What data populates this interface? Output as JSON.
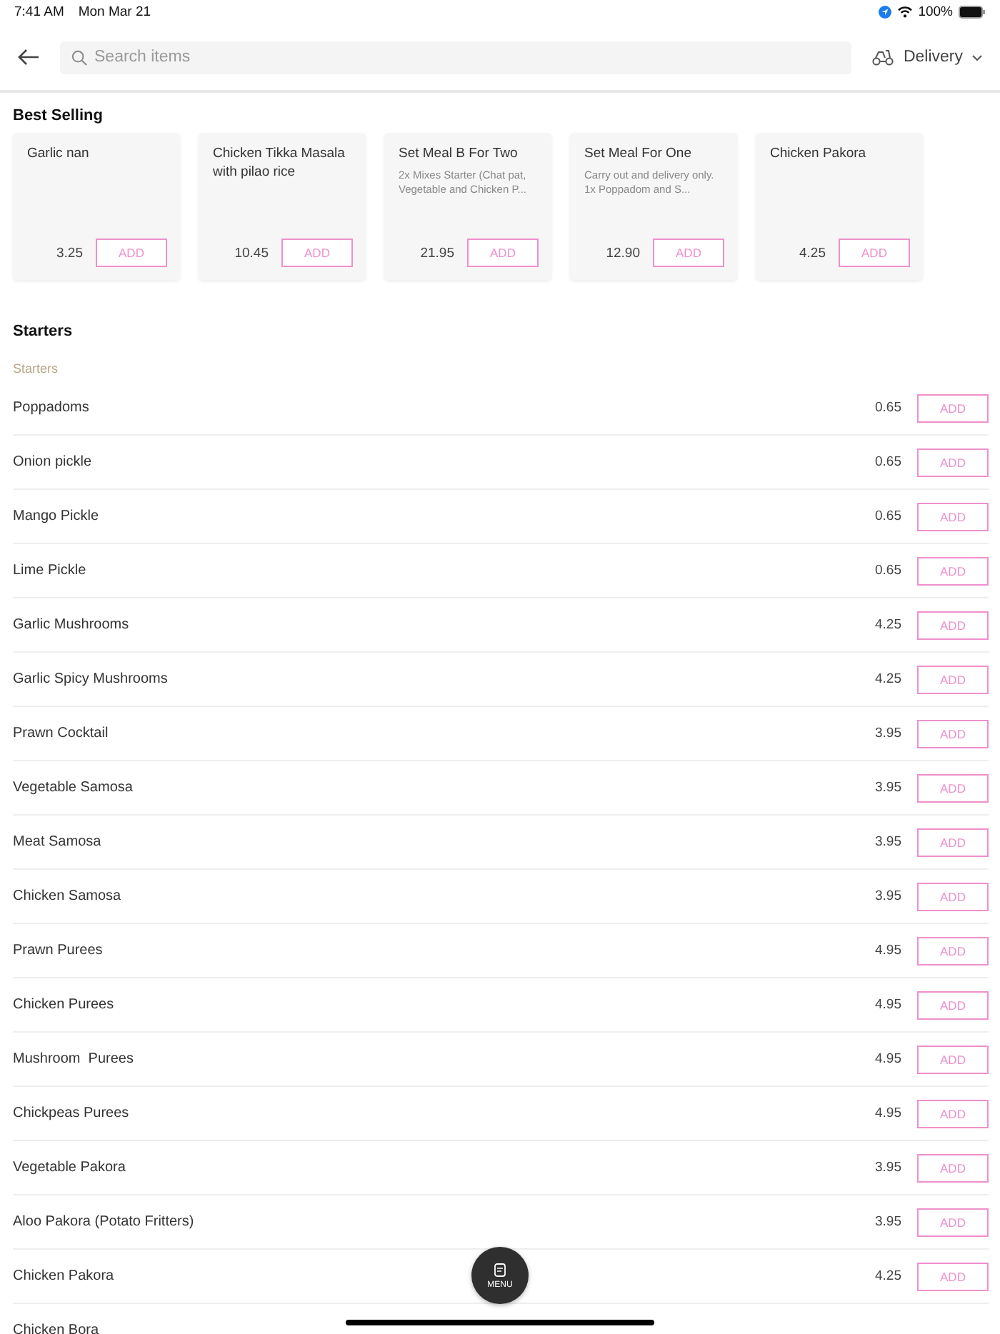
{
  "status_bar": {
    "time": "7:41 AM",
    "date": "Mon Mar 21",
    "battery": "100%"
  },
  "header": {
    "search": {
      "placeholder": "Search items"
    },
    "delivery": "Delivery"
  },
  "best_selling": {
    "title": "Best Selling",
    "items": [
      {
        "name": "Garlic nan",
        "price": "3.25",
        "button": "ADD"
      },
      {
        "name": "Chicken Tikka Masala with pilao rice",
        "price": "10.45",
        "button": "ADD"
      },
      {
        "name": "Set Meal B For Two",
        "description": "2x Mixes Starter (Chat pat, Vegetable and Chicken P...",
        "price": "21.95",
        "button": "ADD"
      },
      {
        "name": "Set Meal For One",
        "description": "Carry out and delivery only. 1x Poppadom and S...",
        "price": "12.90",
        "button": "ADD"
      },
      {
        "name": "Chicken Pakora",
        "price": "4.25",
        "button": "ADD"
      }
    ]
  },
  "section": {
    "title": "Starters",
    "subtitle": "Starters",
    "items": [
      {
        "name": "Poppadoms",
        "price": "0.65",
        "button": "ADD"
      },
      {
        "name": "Onion pickle",
        "price": "0.65",
        "button": "ADD"
      },
      {
        "name": "Mango Pickle",
        "price": "0.65",
        "button": "ADD"
      },
      {
        "name": "Lime Pickle",
        "price": "0.65",
        "button": "ADD"
      },
      {
        "name": "Garlic Mushrooms",
        "price": "4.25",
        "button": "ADD"
      },
      {
        "name": "Garlic Spicy Mushrooms",
        "price": "4.25",
        "button": "ADD"
      },
      {
        "name": "Prawn Cocktail",
        "price": "3.95",
        "button": "ADD"
      },
      {
        "name": "Vegetable Samosa",
        "price": "3.95",
        "button": "ADD"
      },
      {
        "name": "Meat Samosa",
        "price": "3.95",
        "button": "ADD"
      },
      {
        "name": "Chicken Samosa",
        "price": "3.95",
        "button": "ADD"
      },
      {
        "name": "Prawn Purees",
        "price": "4.95",
        "button": "ADD"
      },
      {
        "name": "Chicken Purees",
        "price": "4.95",
        "button": "ADD"
      },
      {
        "name": "Mushroom  Purees",
        "price": "4.95",
        "button": "ADD"
      },
      {
        "name": "Chickpeas Purees",
        "price": "4.95",
        "button": "ADD"
      },
      {
        "name": "Vegetable Pakora",
        "price": "3.95",
        "button": "ADD"
      },
      {
        "name": "Aloo Pakora (Potato Fritters)",
        "price": "3.95",
        "button": "ADD"
      },
      {
        "name": "Chicken Pakora",
        "price": "4.25",
        "button": "ADD"
      },
      {
        "name": "Chicken Bora"
      }
    ]
  },
  "menu_button": "MENU"
}
